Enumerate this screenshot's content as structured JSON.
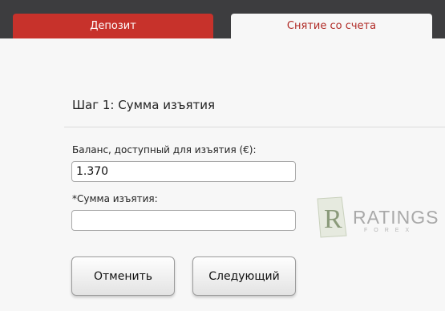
{
  "tabs": {
    "deposit": "Депозит",
    "withdraw": "Снятие со счета"
  },
  "step": {
    "title": "Шаг 1: Сумма изъятия"
  },
  "balance": {
    "label": "Баланс, доступный для изъятия (€):",
    "value": "1.370"
  },
  "amount": {
    "label": "*Сумма изъятия:",
    "value": ""
  },
  "buttons": {
    "cancel": "Отменить",
    "next": "Следующий"
  },
  "watermark": {
    "brand": "RATINGS",
    "sub": "FOREX"
  },
  "colors": {
    "accent": "#c7322b",
    "topbar": "#3d3d3f"
  }
}
